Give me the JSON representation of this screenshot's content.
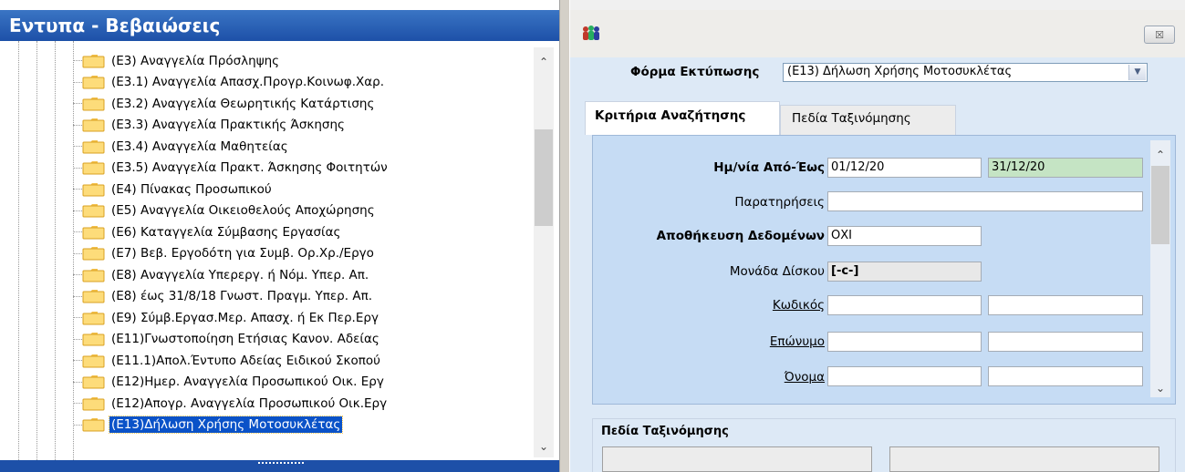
{
  "left_panel": {
    "title": "Εντυπα - Βεβαιώσεις",
    "items": [
      {
        "label": "(Ε3) Αναγγελία Πρόσληψης"
      },
      {
        "label": "(Ε3.1) Αναγγελία Απασχ.Προγρ.Κοινωφ.Χαρ."
      },
      {
        "label": "(Ε3.2) Αναγγελία Θεωρητικής Κατάρτισης"
      },
      {
        "label": "(Ε3.3) Αναγγελία Πρακτικής Άσκησης"
      },
      {
        "label": "(Ε3.4) Αναγγελία Μαθητείας"
      },
      {
        "label": "(Ε3.5) Αναγγελία Πρακτ. Άσκησης Φοιτητών"
      },
      {
        "label": "(Ε4) Πίνακας Προσωπικού"
      },
      {
        "label": "(Ε5) Αναγγελία Οικειοθελούς Αποχώρησης"
      },
      {
        "label": "(Ε6) Καταγγελία Σύμβασης Εργασίας"
      },
      {
        "label": "(Ε7) Βεβ. Εργοδότη για Συμβ. Ορ.Χρ./Εργο"
      },
      {
        "label": "(Ε8) Αναγγελία Υπερεργ. ή Νόμ. Υπερ. Απ."
      },
      {
        "label": "(Ε8) έως 31/8/18 Γνωστ. Πραγμ. Υπερ. Απ."
      },
      {
        "label": "(Ε9) Σύμβ.Εργασ.Μερ. Απασχ. ή Εκ Περ.Εργ"
      },
      {
        "label": "(Ε11)Γνωστοποίηση Ετήσιας Κανον. Αδείας"
      },
      {
        "label": "(Ε11.1)Απολ.Έντυπο Αδείας Ειδικού Σκοπού"
      },
      {
        "label": "(Ε12)Ημερ. Αναγγελία Προσωπικού Οικ. Εργ"
      },
      {
        "label": "(Ε12)Απογρ. Αναγγελία Προσωπικού Οικ.Εργ"
      },
      {
        "label": "(Ε13)Δήλωση Χρήσης Μοτοσυκλέτας",
        "selected": true
      }
    ]
  },
  "right_panel": {
    "form_label": "Φόρμα Εκτύπωσης",
    "form_value": "(Ε13) Δήλωση Χρήσης Μοτοσυκλέτας",
    "tabs": [
      "Κριτήρια Αναζήτησης",
      "Πεδία Ταξινόμησης"
    ],
    "fields": {
      "date_label": "Ημ/νία Από-Έως",
      "date_from": "01/12/20",
      "date_to": "31/12/20",
      "notes_label": "Παρατηρήσεις",
      "notes_value": "",
      "save_label": "Αποθήκευση Δεδομένων",
      "save_value": "ΟΧΙ",
      "disk_label": "Μονάδα Δίσκου",
      "disk_value": "[-c-]",
      "code_label": "Κωδικός",
      "surname_label": "Επώνυμο",
      "name_label": "Όνομα"
    },
    "sort_group_label": "Πεδία Ταξινόμησης",
    "close_symbol": "☒"
  },
  "colors": {
    "title_bar": "#1d50a8",
    "selection": "#0a52c8",
    "panel_bg": "#c6dcf4",
    "green_field": "#c5e4c4"
  }
}
